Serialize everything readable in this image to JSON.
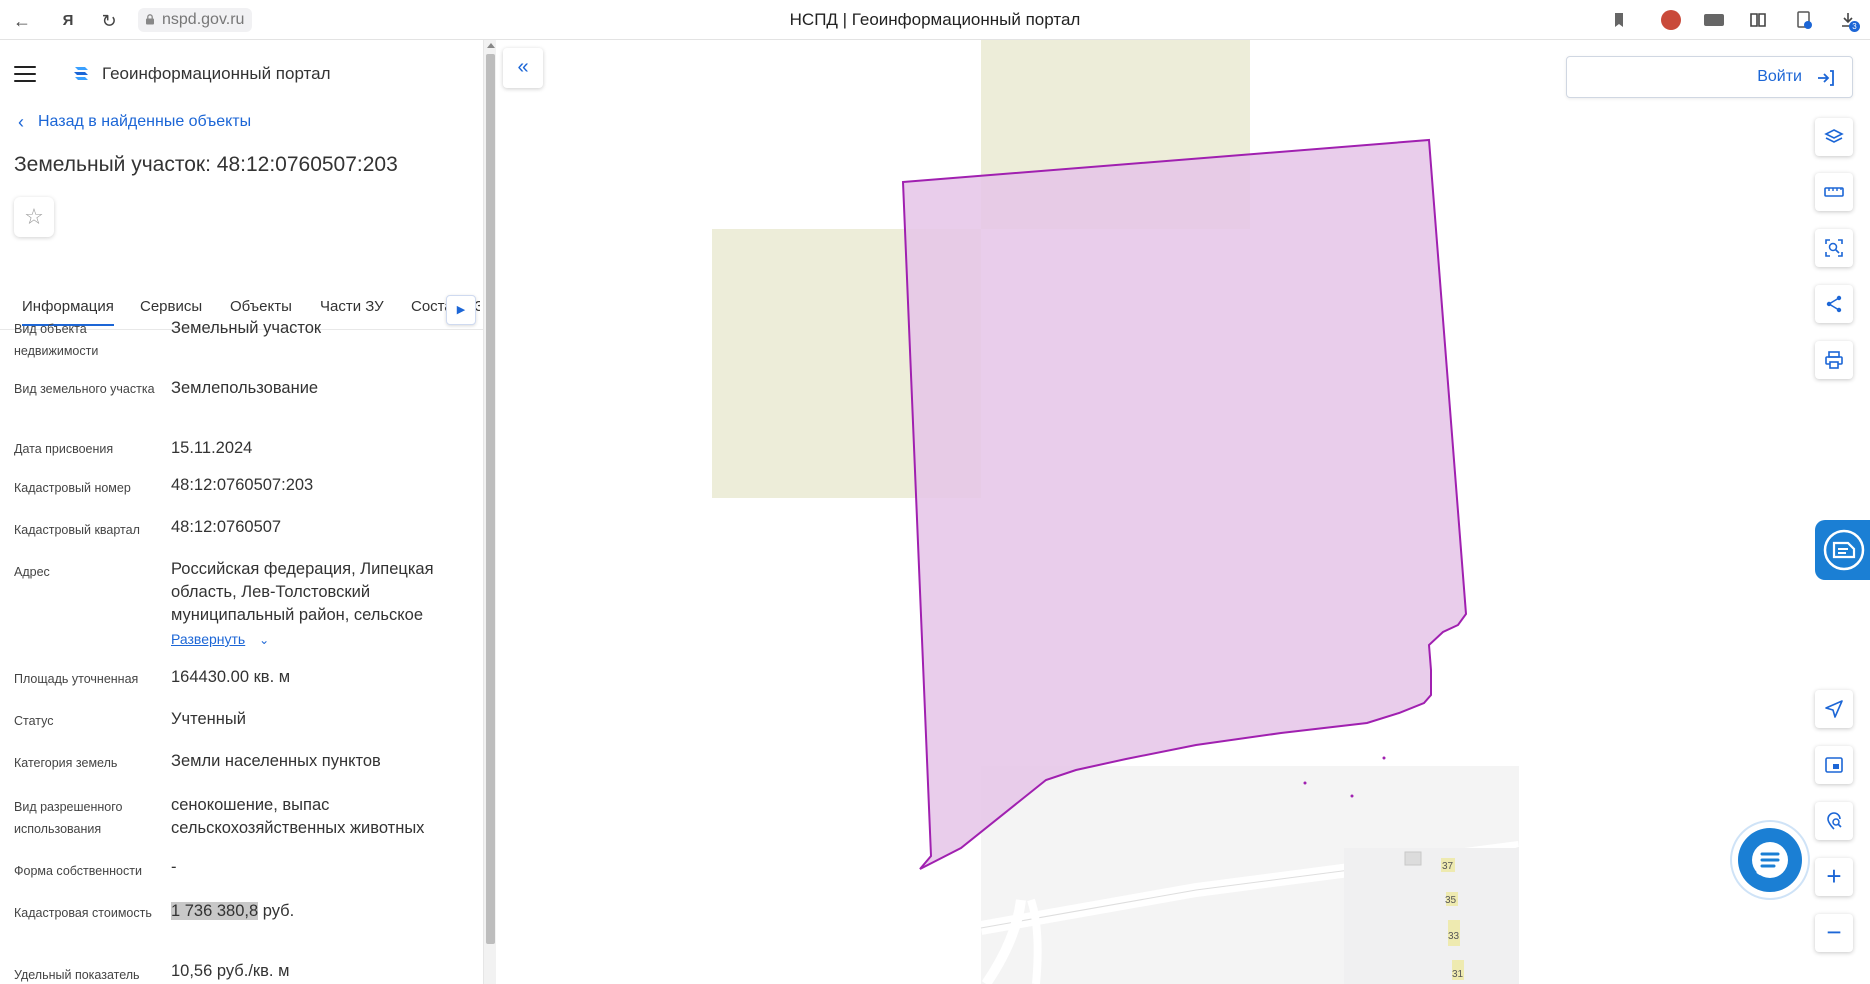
{
  "browser": {
    "url": "nspd.gov.ru",
    "tab_title": "НСПД | Геоинформационный портал",
    "yandex_glyph": "Я",
    "download_badge": "3"
  },
  "header": {
    "portal_title": "Геоинформационный портал"
  },
  "panel": {
    "back_link": "Назад в найденные объекты",
    "object_title": "Земельный участок: 48:12:0760507:203",
    "star_glyph": "☆",
    "tabs": [
      {
        "label": "Информация",
        "active": true
      },
      {
        "label": "Сервисы"
      },
      {
        "label": "Объекты"
      },
      {
        "label": "Части ЗУ"
      },
      {
        "label": "Состав ЕЗП"
      }
    ],
    "properties": [
      {
        "label": "Вид объекта недвижимости",
        "value": "Земельный участок"
      },
      {
        "label": "Вид земельного участка",
        "value": "Землепользование"
      },
      {
        "label": "Дата присвоения",
        "value": "15.11.2024"
      },
      {
        "label": "Кадастровый номер",
        "value": "48:12:0760507:203"
      },
      {
        "label": "Кадастровый квартал",
        "value": "48:12:0760507"
      },
      {
        "label": "Адрес",
        "value": "Российская федерация, Липецкая область, Лев-Толстовский муниципальный район, сельское",
        "expand": "Развернуть"
      },
      {
        "label": "Площадь уточненная",
        "value": "164430.00 кв. м"
      },
      {
        "label": "Статус",
        "value": "Учтенный"
      },
      {
        "label": "Категория земель",
        "value": "Земли населенных пунктов"
      },
      {
        "label": "Вид разрешенного использования",
        "value": "сенокошение, выпас сельскохозяйственных животных"
      },
      {
        "label": "Форма собственности",
        "value": "-"
      },
      {
        "label": "Кадастровая стоимость",
        "value_highlight": "1 736 380,8",
        "value_suffix": " руб."
      },
      {
        "label": "Удельный показатель",
        "value": "10,56 руб./кв. м"
      }
    ]
  },
  "map": {
    "login_label": "Войти",
    "house_numbers": [
      "37",
      "35",
      "33",
      "31"
    ],
    "colors": {
      "parcel_fill": "#e5c4e8",
      "parcel_stroke": "#a020b0",
      "quarter_fill": "#ededd9",
      "accent": "#1c66d6"
    }
  },
  "tools": [
    {
      "name": "layers-icon"
    },
    {
      "name": "ruler-icon"
    },
    {
      "name": "area-select-icon"
    },
    {
      "name": "share-icon"
    },
    {
      "name": "print-icon"
    },
    {
      "name": "navigate-icon"
    },
    {
      "name": "minimap-icon"
    },
    {
      "name": "location-search-icon"
    },
    {
      "name": "zoom-in-icon",
      "glyph": "+"
    },
    {
      "name": "zoom-out-icon",
      "glyph": "−"
    }
  ]
}
